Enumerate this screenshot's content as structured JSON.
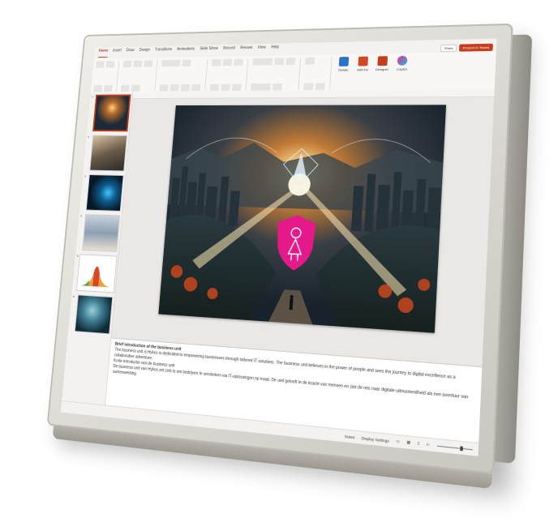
{
  "ribbon": {
    "tabs": [
      "Home",
      "Insert",
      "Draw",
      "Design",
      "Transitions",
      "Animations",
      "Slide Show",
      "Record",
      "Review",
      "View",
      "Help"
    ],
    "active_tab": "Home",
    "share_label": "Share",
    "present_label": "Present in Teams",
    "groups": {
      "dictate_label": "Dictate",
      "designer_label": "Designer",
      "addins_label": "Add-ins",
      "copilot_label": "Copilot"
    }
  },
  "slides": {
    "count": 6,
    "selected_index": 1
  },
  "notes": {
    "heading": "Brief introduction of the business unit",
    "line1": "The business unit is Hykos is dedicated to empowering businesses through tailored IT solutions. The business unit believes in the power of people and sees the journey to digital excellence as a collaborative adventure.",
    "line2": "Korte introductie van de business unit",
    "line3": "De business unit van Hykos zet zich in om bedrijven te versterken via IT-oplossingen op maat. De unit gelooft in de kracht van mensen en ziet de reis naar digitale uitmuntendheid als een avontuur van samenwerking."
  },
  "status": {
    "notes_label": "Notes",
    "display_label": "Display Settings"
  },
  "colors": {
    "accent": "#c43e1c",
    "shield": "#e6198a"
  }
}
